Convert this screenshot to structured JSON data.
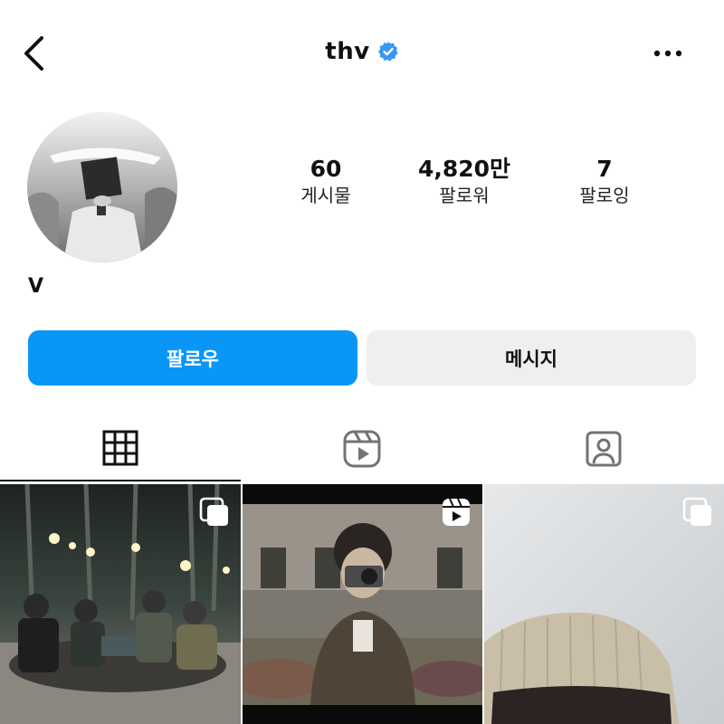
{
  "header": {
    "username": "thv",
    "back_icon": "chevron-left-icon",
    "verified_icon": "verified-badge-icon",
    "more_icon": "more-horizontal-icon",
    "verified_color": "#3897f0"
  },
  "profile": {
    "display_name": "V",
    "stats": [
      {
        "value": "60",
        "label": "게시물"
      },
      {
        "value": "4,820만",
        "label": "팔로워"
      },
      {
        "value": "7",
        "label": "팔로잉"
      }
    ]
  },
  "actions": {
    "follow_label": "팔로우",
    "message_label": "메시지",
    "follow_color": "#0a96f6",
    "message_color": "#efefef"
  },
  "tabs": [
    {
      "icon": "grid-icon",
      "active": true
    },
    {
      "icon": "reels-icon",
      "active": false
    },
    {
      "icon": "tagged-icon",
      "active": false
    }
  ],
  "posts": [
    {
      "type": "carousel",
      "badge_icon": "carousel-icon"
    },
    {
      "type": "reel",
      "badge_icon": "reels-icon"
    },
    {
      "type": "carousel",
      "badge_icon": "carousel-icon"
    }
  ]
}
